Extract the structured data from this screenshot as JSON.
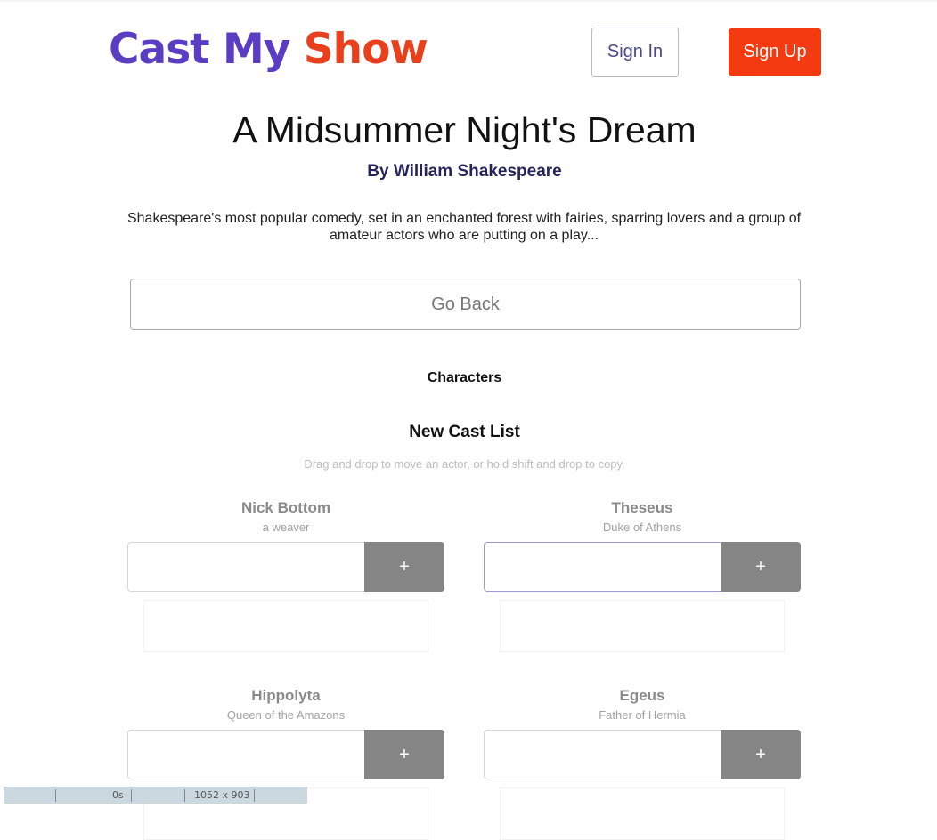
{
  "brand": {
    "word1": "Cast My",
    "word2": "Show",
    "color1": "#5b3dc4",
    "color2": "#e8401c"
  },
  "header": {
    "sign_in": "Sign In",
    "sign_up": "Sign Up",
    "sign_up_color": "#f43a10"
  },
  "play": {
    "title": "A Midsummer Night's Dream",
    "author": "By William Shakespeare",
    "description": "Shakespeare's most popular comedy, set in an enchanted forest with fairies, sparring lovers and a group of amateur actors who are putting on a play..."
  },
  "go_back": "Go Back",
  "characters_heading": "Characters",
  "cast_list": {
    "heading": "New Cast List",
    "hint": "Drag and drop to move an actor, or hold shift and drop to copy.",
    "add_label": "+",
    "roles": [
      {
        "name": "Nick Bottom",
        "desc": "a weaver",
        "value": ""
      },
      {
        "name": "Theseus",
        "desc": "Duke of Athens",
        "value": ""
      },
      {
        "name": "Hippolyta",
        "desc": "Queen of the Amazons",
        "value": ""
      },
      {
        "name": "Egeus",
        "desc": "Father of Hermia",
        "value": ""
      }
    ]
  },
  "devbar": {
    "time": "0s",
    "size": "1052 x 903"
  }
}
